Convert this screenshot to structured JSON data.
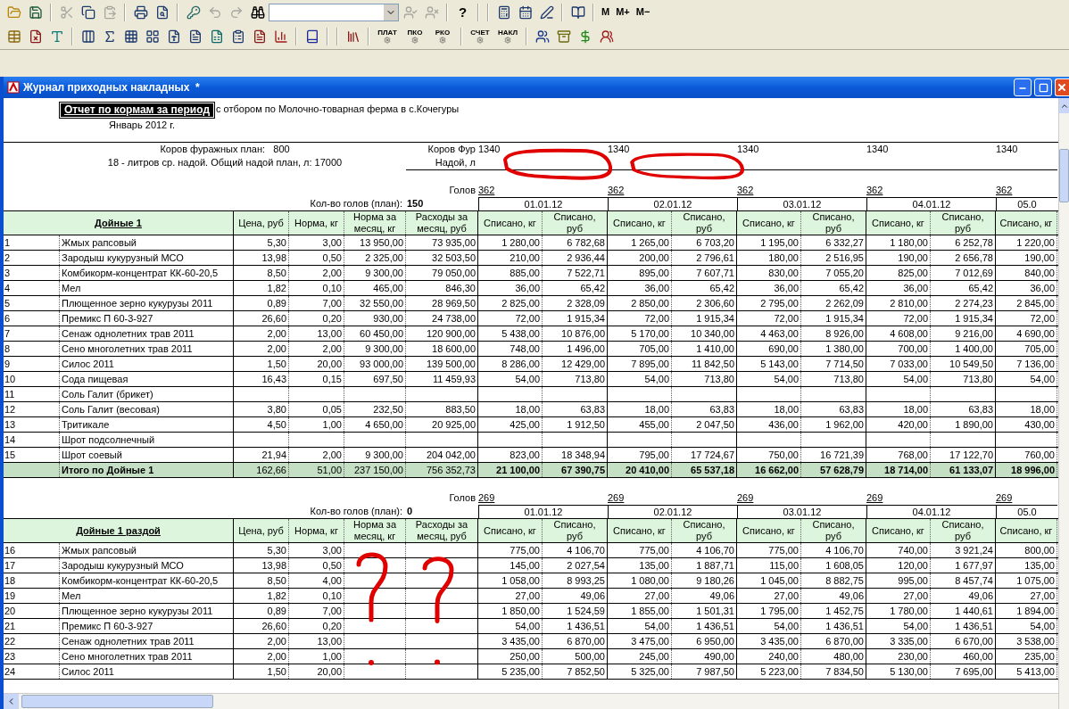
{
  "toolbar": {
    "help": "?",
    "memory_buttons": [
      "M",
      "M+",
      "M−"
    ],
    "doc_buttons": [
      "ПЛАТ",
      "ПКО",
      "РКО",
      "СЧЕТ",
      "НАКЛ"
    ]
  },
  "window": {
    "title": "Журнал приходных накладных  *"
  },
  "report": {
    "title": "Отчет по кормам за период",
    "filter": "с отбором по Молочно-товарная ферма в с.Кочегуры",
    "period": "Январь 2012 г.",
    "plan_line": "Коров фуражных план:   800",
    "yield_line": "18 - литров ср. надой. Общий надой план, л: 17000",
    "cows_label": "Коров Фур",
    "cows": [
      "1340",
      "1340",
      "1340",
      "1340",
      "1340"
    ],
    "yield_label": "Надой, л"
  },
  "sections": [
    {
      "heads_label": "Голов",
      "heads": [
        "362",
        "362",
        "362",
        "362",
        "362"
      ],
      "plan_label": "Кол-во голов (план):",
      "plan": "150",
      "dates": [
        "01.01.12",
        "02.01.12",
        "03.01.12",
        "04.01.12",
        "05.0"
      ],
      "title": "Дойные 1",
      "columns": [
        "Цена, руб",
        "Норма, кг",
        "Норма за месяц, кг",
        "Расходы за месяц, руб"
      ],
      "day_columns": [
        "Списано, кг",
        "Списано, руб",
        "Списано, кг",
        "Списано, руб",
        "Списано, кг",
        "Списано, руб",
        "Списано, кг",
        "Списано, руб",
        "Списано, кг"
      ],
      "rows": [
        {
          "num": "1",
          "name": "Жмых рапсовый",
          "values": [
            "5,30",
            "3,00",
            "13 950,00",
            "73 935,00"
          ],
          "days": [
            "1 280,00",
            "6 782,68",
            "1 265,00",
            "6 703,20",
            "1 195,00",
            "6 332,27",
            "1 180,00",
            "6 252,78",
            "1 220,00"
          ]
        },
        {
          "num": "2",
          "name": "Зародыш кукурузный МСО",
          "values": [
            "13,98",
            "0,50",
            "2 325,00",
            "32 503,50"
          ],
          "days": [
            "210,00",
            "2 936,44",
            "200,00",
            "2 796,61",
            "180,00",
            "2 516,95",
            "190,00",
            "2 656,78",
            "190,00"
          ]
        },
        {
          "num": "3",
          "name": "Комбикорм-концентрат КК-60-20,5",
          "values": [
            "8,50",
            "2,00",
            "9 300,00",
            "79 050,00"
          ],
          "days": [
            "885,00",
            "7 522,71",
            "895,00",
            "7 607,71",
            "830,00",
            "7 055,20",
            "825,00",
            "7 012,69",
            "840,00"
          ]
        },
        {
          "num": "4",
          "name": "Мел",
          "values": [
            "1,82",
            "0,10",
            "465,00",
            "846,30"
          ],
          "days": [
            "36,00",
            "65,42",
            "36,00",
            "65,42",
            "36,00",
            "65,42",
            "36,00",
            "65,42",
            "36,00"
          ]
        },
        {
          "num": "5",
          "name": "Плющенное зерно кукурузы 2011",
          "values": [
            "0,89",
            "7,00",
            "32 550,00",
            "28 969,50"
          ],
          "days": [
            "2 825,00",
            "2 328,09",
            "2 850,00",
            "2 306,60",
            "2 795,00",
            "2 262,09",
            "2 810,00",
            "2 274,23",
            "2 845,00"
          ]
        },
        {
          "num": "6",
          "name": "Премикс П 60-3-927",
          "values": [
            "26,60",
            "0,20",
            "930,00",
            "24 738,00"
          ],
          "days": [
            "72,00",
            "1 915,34",
            "72,00",
            "1 915,34",
            "72,00",
            "1 915,34",
            "72,00",
            "1 915,34",
            "72,00"
          ]
        },
        {
          "num": "7",
          "name": "Сенаж однолетних трав 2011",
          "values": [
            "2,00",
            "13,00",
            "60 450,00",
            "120 900,00"
          ],
          "days": [
            "5 438,00",
            "10 876,00",
            "5 170,00",
            "10 340,00",
            "4 463,00",
            "8 926,00",
            "4 608,00",
            "9 216,00",
            "4 690,00"
          ]
        },
        {
          "num": "8",
          "name": "Сено многолетних трав 2011",
          "values": [
            "2,00",
            "2,00",
            "9 300,00",
            "18 600,00"
          ],
          "days": [
            "748,00",
            "1 496,00",
            "705,00",
            "1 410,00",
            "690,00",
            "1 380,00",
            "700,00",
            "1 400,00",
            "705,00"
          ]
        },
        {
          "num": "9",
          "name": "Силос 2011",
          "values": [
            "1,50",
            "20,00",
            "93 000,00",
            "139 500,00"
          ],
          "days": [
            "8 286,00",
            "12 429,00",
            "7 895,00",
            "11 842,50",
            "5 143,00",
            "7 714,50",
            "7 033,00",
            "10 549,50",
            "7 136,00"
          ]
        },
        {
          "num": "10",
          "name": "Сода пищевая",
          "values": [
            "16,43",
            "0,15",
            "697,50",
            "11 459,93"
          ],
          "days": [
            "54,00",
            "713,80",
            "54,00",
            "713,80",
            "54,00",
            "713,80",
            "54,00",
            "713,80",
            "54,00"
          ]
        },
        {
          "num": "11",
          "name": "Соль Галит (брикет)"
        },
        {
          "num": "12",
          "name": "Соль Галит (весовая)",
          "values": [
            "3,80",
            "0,05",
            "232,50",
            "883,50"
          ],
          "days": [
            "18,00",
            "63,83",
            "18,00",
            "63,83",
            "18,00",
            "63,83",
            "18,00",
            "63,83",
            "18,00"
          ]
        },
        {
          "num": "13",
          "name": "Тритикале",
          "values": [
            "4,50",
            "1,00",
            "4 650,00",
            "20 925,00"
          ],
          "days": [
            "425,00",
            "1 912,50",
            "455,00",
            "2 047,50",
            "436,00",
            "1 962,00",
            "420,00",
            "1 890,00",
            "430,00"
          ]
        },
        {
          "num": "14",
          "name": "Шрот подсолнечный"
        },
        {
          "num": "15",
          "name": "Шрот соевый",
          "values": [
            "21,94",
            "2,00",
            "9 300,00",
            "204 042,00"
          ],
          "days": [
            "823,00",
            "18 348,94",
            "795,00",
            "17 724,67",
            "750,00",
            "16 721,39",
            "768,00",
            "17 122,70",
            "760,00"
          ]
        }
      ],
      "total": {
        "name": "Итого по Дойные 1",
        "values": [
          "162,66",
          "51,00",
          "237 150,00",
          "756 352,73"
        ],
        "days": [
          "21 100,00",
          "67 390,75",
          "20 410,00",
          "65 537,18",
          "16 662,00",
          "57 628,79",
          "18 714,00",
          "61 133,07",
          "18 996,00"
        ]
      }
    },
    {
      "heads_label": "Голов",
      "heads": [
        "269",
        "269",
        "269",
        "269",
        "269"
      ],
      "plan_label": "Кол-во голов (план):",
      "plan": "0",
      "dates": [
        "01.01.12",
        "02.01.12",
        "03.01.12",
        "04.01.12",
        "05.0"
      ],
      "title": "Дойные 1 раздой",
      "columns": [
        "Цена, руб",
        "Норма, кг",
        "Норма за месяц, кг",
        "Расходы за месяц, руб"
      ],
      "day_columns": [
        "Списано, кг",
        "Списано, руб",
        "Списано, кг",
        "Списано, руб",
        "Списано, кг",
        "Списано, руб",
        "Списано, кг",
        "Списано, руб",
        "Списано, кг"
      ],
      "rows": [
        {
          "num": "16",
          "name": "Жмых рапсовый",
          "values": [
            "5,30",
            "3,00"
          ],
          "days": [
            "775,00",
            "4 106,70",
            "775,00",
            "4 106,70",
            "775,00",
            "4 106,70",
            "740,00",
            "3 921,24",
            "800,00"
          ]
        },
        {
          "num": "17",
          "name": "Зародыш кукурузный МСО",
          "values": [
            "13,98",
            "0,50"
          ],
          "days": [
            "145,00",
            "2 027,54",
            "135,00",
            "1 887,71",
            "115,00",
            "1 608,05",
            "120,00",
            "1 677,97",
            "135,00"
          ]
        },
        {
          "num": "18",
          "name": "Комбикорм-концентрат КК-60-20,5",
          "values": [
            "8,50",
            "4,00"
          ],
          "days": [
            "1 058,00",
            "8 993,25",
            "1 080,00",
            "9 180,26",
            "1 045,00",
            "8 882,75",
            "995,00",
            "8 457,74",
            "1 075,00"
          ]
        },
        {
          "num": "19",
          "name": "Мел",
          "values": [
            "1,82",
            "0,10"
          ],
          "days": [
            "27,00",
            "49,06",
            "27,00",
            "49,06",
            "27,00",
            "49,06",
            "27,00",
            "49,06",
            "27,00"
          ]
        },
        {
          "num": "20",
          "name": "Плющенное зерно кукурузы 2011",
          "values": [
            "0,89",
            "7,00"
          ],
          "days": [
            "1 850,00",
            "1 524,59",
            "1 855,00",
            "1 501,31",
            "1 795,00",
            "1 452,75",
            "1 780,00",
            "1 440,61",
            "1 894,00"
          ]
        },
        {
          "num": "21",
          "name": "Премикс П 60-3-927",
          "values": [
            "26,60",
            "0,20"
          ],
          "days": [
            "54,00",
            "1 436,51",
            "54,00",
            "1 436,51",
            "54,00",
            "1 436,51",
            "54,00",
            "1 436,51",
            "54,00"
          ]
        },
        {
          "num": "22",
          "name": "Сенаж однолетних трав 2011",
          "values": [
            "2,00",
            "13,00"
          ],
          "days": [
            "3 435,00",
            "6 870,00",
            "3 475,00",
            "6 950,00",
            "3 435,00",
            "6 870,00",
            "3 335,00",
            "6 670,00",
            "3 538,00"
          ]
        },
        {
          "num": "23",
          "name": "Сено многолетних трав 2011",
          "values": [
            "2,00",
            "1,00"
          ],
          "days": [
            "250,00",
            "500,00",
            "245,00",
            "490,00",
            "240,00",
            "480,00",
            "230,00",
            "460,00",
            "235,00"
          ]
        },
        {
          "num": "24",
          "name": "Силос 2011",
          "values": [
            "1,50",
            "20,00"
          ],
          "days": [
            "5 235,00",
            "7 852,50",
            "5 325,00",
            "7 987,50",
            "5 223,00",
            "7 834,50",
            "5 130,00",
            "7 695,00",
            "5 413,00"
          ]
        }
      ]
    }
  ],
  "annotations": [
    {
      "kind": "oval"
    },
    {
      "kind": "oval"
    },
    {
      "kind": "question"
    },
    {
      "kind": "question"
    }
  ]
}
